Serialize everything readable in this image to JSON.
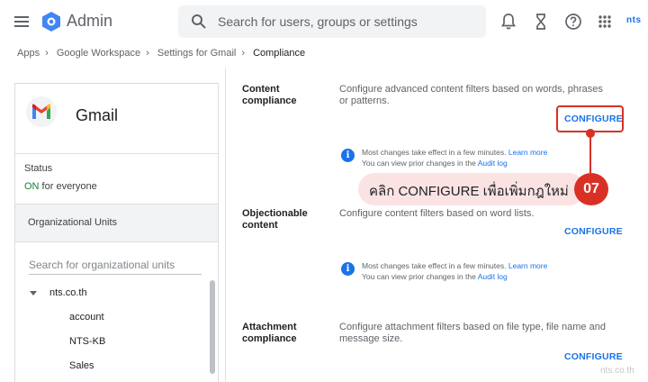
{
  "app": {
    "title": "Admin"
  },
  "search": {
    "placeholder": "Search for users, groups or settings"
  },
  "brand": {
    "logo_text": "nts"
  },
  "breadcrumb": [
    "Apps",
    "Google Workspace",
    "Settings for Gmail",
    "Compliance"
  ],
  "sidebar": {
    "app_name": "Gmail",
    "status_label": "Status",
    "status_on": "ON",
    "status_rest": " for everyone",
    "org_units_title": "Organizational Units",
    "org_search_placeholder": "Search for organizational units",
    "tree": {
      "root": "nts.co.th",
      "children": [
        "account",
        "NTS-KB",
        "Sales"
      ]
    }
  },
  "sections": [
    {
      "title": "Content compliance",
      "description": "Configure advanced content filters based on words, phrases or patterns.",
      "action": "CONFIGURE",
      "info_line1": "Most changes take effect in a few minutes. ",
      "info_link1": "Learn more",
      "info_line2": "You can view prior changes in the ",
      "info_link2": "Audit log"
    },
    {
      "title": "Objectionable content",
      "description": "Configure content filters based on word lists.",
      "action": "CONFIGURE",
      "info_line1": "Most changes take effect in a few minutes. ",
      "info_link1": "Learn more",
      "info_line2": "You can view prior changes in the ",
      "info_link2": "Audit log"
    },
    {
      "title": "Attachment compliance",
      "description": "Configure attachment filters based on file type, file name and message size.",
      "action": "CONFIGURE"
    }
  ],
  "callout": {
    "text": "คลิก CONFIGURE เพื่อเพิ่มกฎใหม่",
    "number": "07"
  },
  "watermark": "nts.co.th",
  "colors": {
    "accent": "#1a73e8",
    "highlight": "#d93025",
    "status_on": "#188038"
  }
}
